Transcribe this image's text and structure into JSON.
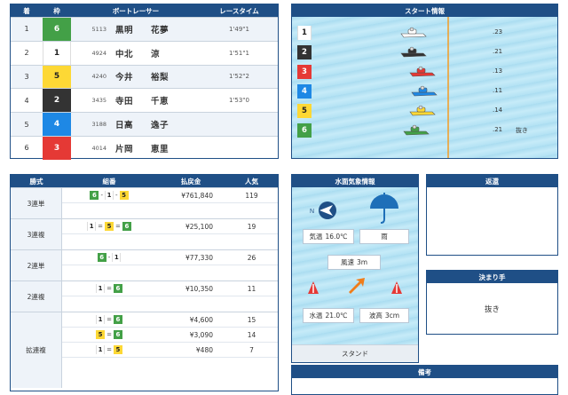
{
  "results": {
    "headers": {
      "pos": "着",
      "frame": "枠",
      "racer": "ボートレーサー",
      "time": "レースタイム"
    },
    "rows": [
      {
        "pos": "1",
        "frame": "6",
        "frame_class": "f6",
        "reg": "5113",
        "name": "黒明　　花夢",
        "time": "1'49\"1"
      },
      {
        "pos": "2",
        "frame": "1",
        "frame_class": "f1",
        "reg": "4924",
        "name": "中北　　涼",
        "time": "1'51\"1"
      },
      {
        "pos": "3",
        "frame": "5",
        "frame_class": "f5",
        "reg": "4240",
        "name": "今井　　裕梨",
        "time": "1'52\"2"
      },
      {
        "pos": "4",
        "frame": "2",
        "frame_class": "f2",
        "reg": "3435",
        "name": "寺田　　千恵",
        "time": "1'53\"0"
      },
      {
        "pos": "5",
        "frame": "4",
        "frame_class": "f4",
        "reg": "3188",
        "name": "日高　　逸子",
        "time": ""
      },
      {
        "pos": "6",
        "frame": "3",
        "frame_class": "f3",
        "reg": "4014",
        "name": "片岡　　恵里",
        "time": ""
      }
    ]
  },
  "start": {
    "title": "スタート情報",
    "rows": [
      {
        "num": "1",
        "frame_class": "f1",
        "boat_color": "#ffffff",
        "time": ".23",
        "note": ""
      },
      {
        "num": "2",
        "frame_class": "f2",
        "boat_color": "#333333",
        "time": ".21",
        "note": ""
      },
      {
        "num": "3",
        "frame_class": "f3",
        "boat_color": "#e53935",
        "time": ".13",
        "note": ""
      },
      {
        "num": "4",
        "frame_class": "f4",
        "boat_color": "#1e88e5",
        "time": ".11",
        "note": ""
      },
      {
        "num": "5",
        "frame_class": "f5",
        "boat_color": "#fdd835",
        "time": ".14",
        "note": ""
      },
      {
        "num": "6",
        "frame_class": "f6",
        "boat_color": "#43a047",
        "time": ".21",
        "note": "抜き"
      }
    ]
  },
  "payout": {
    "headers": {
      "type": "勝式",
      "combo": "組番",
      "amount": "払戻金",
      "pop": "人気"
    },
    "groups": [
      {
        "type": "3連単",
        "entries": [
          {
            "combo": [
              "6",
              "-",
              "1",
              "-",
              "5"
            ],
            "amount": "¥761,840",
            "pop": "119"
          }
        ]
      },
      {
        "type": "3連複",
        "entries": [
          {
            "combo": [
              "1",
              "=",
              "5",
              "=",
              "6"
            ],
            "amount": "¥25,100",
            "pop": "19"
          }
        ]
      },
      {
        "type": "2連単",
        "entries": [
          {
            "combo": [
              "6",
              "-",
              "1"
            ],
            "amount": "¥77,330",
            "pop": "26"
          }
        ]
      },
      {
        "type": "2連複",
        "entries": [
          {
            "combo": [
              "1",
              "=",
              "6"
            ],
            "amount": "¥10,350",
            "pop": "11"
          }
        ]
      },
      {
        "type": "拡連複",
        "entries": [
          {
            "combo": [
              "1",
              "=",
              "6"
            ],
            "amount": "¥4,600",
            "pop": "15"
          },
          {
            "combo": [
              "5",
              "=",
              "6"
            ],
            "amount": "¥3,090",
            "pop": "14"
          },
          {
            "combo": [
              "1",
              "=",
              "5"
            ],
            "amount": "¥480",
            "pop": "7"
          }
        ]
      }
    ]
  },
  "weather": {
    "title": "水面気象情報",
    "temp_label": "気温",
    "temp": "16.0℃",
    "condition": "雨",
    "wind_label": "風速",
    "wind": "3m",
    "water_label": "水温",
    "water": "21.0℃",
    "wave_label": "波高",
    "wave": "3cm",
    "stand": "スタンド"
  },
  "henkan": {
    "title": "返還"
  },
  "kimarite": {
    "title": "決まり手",
    "value": "抜き"
  },
  "biko": {
    "title": "備考"
  },
  "frame_colors": {
    "1": "#ffffff",
    "2": "#333333",
    "3": "#e53935",
    "4": "#1e88e5",
    "5": "#fdd835",
    "6": "#43a047"
  }
}
